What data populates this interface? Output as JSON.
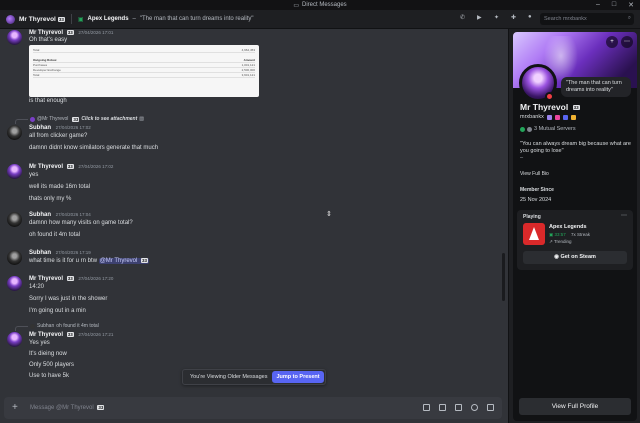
{
  "window": {
    "title": "Direct Messages"
  },
  "topbar": {
    "username": "Mr Thyrevol",
    "tag_badge": "33",
    "status_game": "Apex Legends",
    "status_quote": "\"The man that can turn dreams into reality\"",
    "search_placeholder": "Search mrxbankx"
  },
  "messages": {
    "m1": {
      "author": "Mr Thyrevol",
      "badge": "33",
      "time": "27/04/2026 17:01",
      "text": "Oh that's easy"
    },
    "m1_embed": {
      "row1_label": "Total",
      "row1_value": "4,962,453",
      "head_label": "Outgoing Robux",
      "head_value": "Amount",
      "row2_label": "Purchases",
      "row2_value": "1,001,121",
      "row3_label": "Developer Exchange",
      "row3_value": "2,500,000",
      "row4_label": "Total",
      "row4_value": "3,601,121"
    },
    "m1_after": "is that enough",
    "m2_reply": {
      "author": "@Mr Thyrevol",
      "badge": "33",
      "text": "Click to see attachment"
    },
    "m2": {
      "author": "Subhan",
      "time": "27/04/2026 17:02",
      "line1": "all from clicker game?",
      "line2": "damnn didnt know similators generate that much"
    },
    "m3": {
      "author": "Mr Thyrevol",
      "badge": "33",
      "time": "27/04/2026 17:02",
      "line1": "yes",
      "line2": "well its made 16m total",
      "line3": "thats only my %"
    },
    "m4": {
      "author": "Subhan",
      "time": "27/04/2026 17:04",
      "line1": "damnn how many visits on game total?",
      "line2": "oh found it 4m total"
    },
    "m5": {
      "author": "Subhan",
      "time": "27/04/2026 17:19",
      "text_before": "what time is it for u rn btw",
      "mention": "@Mr Thyrevol",
      "mention_badge": "33"
    },
    "m6": {
      "author": "Mr Thyrevol",
      "badge": "33",
      "time": "27/04/2026 17:20",
      "line1": "14:20",
      "line2": "Sorry I was just in the shower",
      "line3": "I'm going out in a min"
    },
    "m7_reply": {
      "author": "Subhan",
      "text": "oh found it 4m total"
    },
    "m7": {
      "author": "Mr Thyrevol",
      "badge": "33",
      "time": "27/04/2026 17:21",
      "line1": "Yes yes",
      "line2": "It's dieing now",
      "line3": "Only 500 players",
      "line4": "Use to have 5k"
    }
  },
  "older_banner": {
    "text": "You're Viewing Older Messages",
    "button": "Jump to Present"
  },
  "composer": {
    "placeholder": "Message @Mr Thyrevol",
    "badge": "33"
  },
  "profile": {
    "bubble": "\"The man that can turn dreams into reality\"",
    "display_name": "Mr Thyrevol",
    "badge": "33",
    "username": "mrxbankx",
    "mutual": "3 Mutual Servers",
    "bio": "\"You can always dream big because what are you going to lose\"",
    "bio_dash": "–",
    "view_full_bio": "View Full Bio",
    "member_since_label": "Member Since",
    "member_since": "25 Nov 2024",
    "playing_label": "Playing",
    "game_name": "Apex Legends",
    "game_time": "33:57",
    "game_streak": "7x Streak",
    "game_trending": "Trending",
    "steam_button": "Get on Steam",
    "view_full_profile": "View Full Profile"
  },
  "colors": {
    "accent": "#5865f2",
    "online_red": "#f23f43",
    "game_red": "#da292a",
    "green": "#23a55a"
  }
}
